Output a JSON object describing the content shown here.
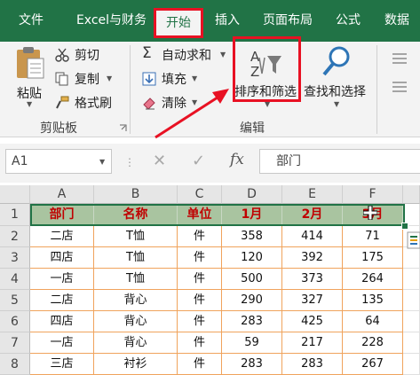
{
  "tabs": [
    {
      "id": "file",
      "label": "文件"
    },
    {
      "id": "finance",
      "label": "Excel与财务"
    },
    {
      "id": "home",
      "label": "开始",
      "active": true
    },
    {
      "id": "insert",
      "label": "插入"
    },
    {
      "id": "layout",
      "label": "页面布局"
    },
    {
      "id": "formula",
      "label": "公式"
    },
    {
      "id": "data",
      "label": "数据"
    }
  ],
  "ribbon": {
    "clipboard": {
      "paste": "粘贴",
      "cut": "剪切",
      "copy": "复制",
      "format_painter": "格式刷",
      "group_label": "剪贴板"
    },
    "editing": {
      "autosum": "自动求和",
      "fill": "填充",
      "clear": "清除",
      "sort_filter": "排序和筛选",
      "find_select": "查找和选择",
      "group_label": "编辑"
    }
  },
  "formula_bar": {
    "name_box": "A1",
    "fx_symbol": "fx",
    "value": "部门"
  },
  "grid": {
    "columns": [
      "A",
      "B",
      "C",
      "D",
      "E",
      "F"
    ],
    "rows": [
      {
        "num": "1",
        "cells": [
          "部门",
          "名称",
          "单位",
          "1月",
          "2月",
          "3月"
        ]
      },
      {
        "num": "2",
        "cells": [
          "二店",
          "T恤",
          "件",
          "358",
          "414",
          "71"
        ]
      },
      {
        "num": "3",
        "cells": [
          "四店",
          "T恤",
          "件",
          "120",
          "392",
          "175"
        ]
      },
      {
        "num": "4",
        "cells": [
          "一店",
          "T恤",
          "件",
          "500",
          "373",
          "264"
        ]
      },
      {
        "num": "5",
        "cells": [
          "二店",
          "背心",
          "件",
          "290",
          "327",
          "135"
        ]
      },
      {
        "num": "6",
        "cells": [
          "四店",
          "背心",
          "件",
          "283",
          "425",
          "64"
        ]
      },
      {
        "num": "7",
        "cells": [
          "一店",
          "背心",
          "件",
          "59",
          "217",
          "228"
        ]
      },
      {
        "num": "8",
        "cells": [
          "三店",
          "衬衫",
          "件",
          "283",
          "283",
          "267"
        ]
      }
    ]
  },
  "colors": {
    "ribbon_green": "#217346",
    "highlight_red": "#e81123",
    "header_fill": "#a9c4a0",
    "header_text": "#c00000",
    "cell_border": "#f0a35c"
  }
}
